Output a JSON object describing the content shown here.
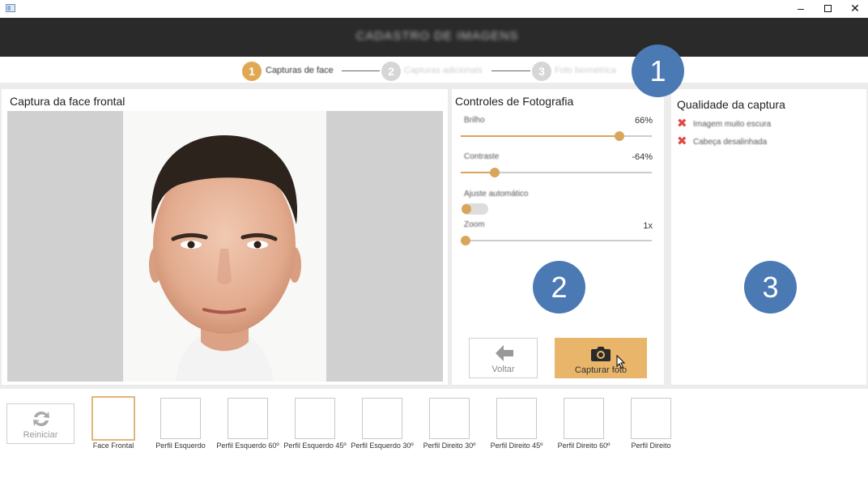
{
  "window": {
    "minimize": "–",
    "close": "✕"
  },
  "header": {
    "title": "CADASTRO DE IMAGENS"
  },
  "stepper": {
    "steps": [
      {
        "number": "1",
        "label": "Capturas de face",
        "active": true
      },
      {
        "number": "2",
        "label": "Capturas adicionais",
        "active": false
      },
      {
        "number": "3",
        "label": "Foto biométrica",
        "active": false
      }
    ]
  },
  "photo_panel": {
    "title": "Captura da face frontal"
  },
  "controls_panel": {
    "title": "Controles de Fotografia",
    "sliders": [
      {
        "label": "Brilho",
        "value_text": "66%",
        "fraction": 0.83
      },
      {
        "label": "Contraste",
        "value_text": "-64%",
        "fraction": 0.18
      },
      {
        "label": "Zoom",
        "value_text": "1x",
        "fraction": 0.0
      }
    ],
    "auto_adjust": {
      "label": "Ajuste automático",
      "on": false
    },
    "back_button": {
      "label": "Voltar",
      "icon": "arrow-left-icon"
    },
    "capture_button": {
      "label": "Capturar foto",
      "icon": "camera-icon"
    }
  },
  "quality_panel": {
    "title": "Qualidade da captura",
    "issues": [
      {
        "text": "Imagem muito escura",
        "icon": "x-icon"
      },
      {
        "text": "Cabeça desalinhada",
        "icon": "x-icon"
      }
    ]
  },
  "badges": [
    "1",
    "2",
    "3"
  ],
  "bottom_bar": {
    "restart_label": "Reiniciar",
    "thumbnails": [
      {
        "label": "Face Frontal",
        "selected": true
      },
      {
        "label": "Perfil Esquerdo",
        "selected": false
      },
      {
        "label": "Perfil Esquerdo 60º",
        "selected": false
      },
      {
        "label": "Perfil Esquerdo 45º",
        "selected": false
      },
      {
        "label": "Perfil Esquerdo 30º",
        "selected": false
      },
      {
        "label": "Perfil Direito 30º",
        "selected": false
      },
      {
        "label": "Perfil Direito 45º",
        "selected": false
      },
      {
        "label": "Perfil Direito 60º",
        "selected": false
      },
      {
        "label": "Perfil Direito",
        "selected": false
      }
    ]
  },
  "colors": {
    "accent": "#e0a853",
    "header_bg": "#2a2a2a",
    "badge": "#4b79b3",
    "error": "#e04a43"
  }
}
